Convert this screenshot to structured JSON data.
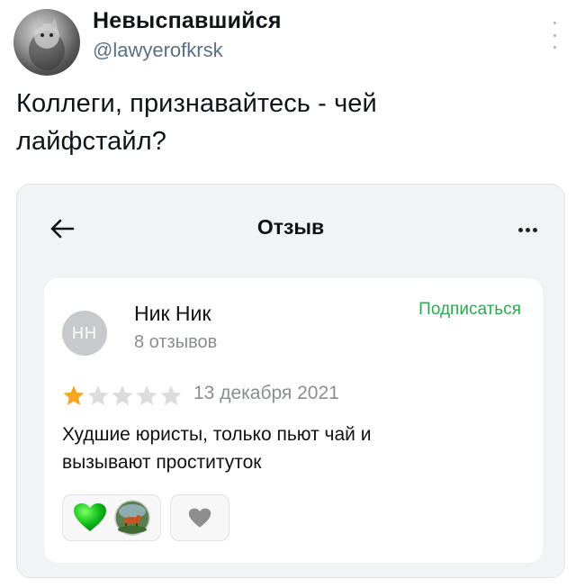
{
  "tweet": {
    "display_name": "Невыспавшийся",
    "handle": "@lawyerofkrsk",
    "text_line1": "Коллеги, признавайтесь - чей",
    "text_line2": "лайфстайл?"
  },
  "screen": {
    "title": "Отзыв"
  },
  "review": {
    "avatar_initials": "НН",
    "author_name": "Ник Ник",
    "review_count": "8 отзывов",
    "subscribe_label": "Подписаться",
    "rating": 1,
    "rating_max": 5,
    "date": "13 декабря 2021",
    "text_line1": "Худшие юристы, только пьют чай и",
    "text_line2": "вызывают проституток"
  },
  "colors": {
    "accent_green": "#2fa84f",
    "star_filled": "#f5a623",
    "star_empty": "#dcdcdc",
    "heart_green": "#12c21e",
    "heart_gray": "#8e8e8e"
  }
}
